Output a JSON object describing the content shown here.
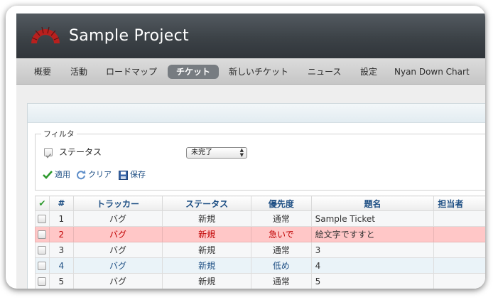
{
  "header": {
    "project_title": "Sample Project",
    "logo_icon": "redmine-logo-icon"
  },
  "menu": {
    "items": [
      {
        "label": "概要"
      },
      {
        "label": "活動"
      },
      {
        "label": "ロードマップ"
      },
      {
        "label": "チケット",
        "selected": true
      },
      {
        "label": "新しいチケット"
      },
      {
        "label": "ニュース"
      },
      {
        "label": "設定"
      },
      {
        "label": "Nyan Down Chart"
      }
    ]
  },
  "filters": {
    "legend": "フィルタ",
    "status_label": "ステータス",
    "status_checked": true,
    "status_operator": "未完了",
    "apply_label": "適用",
    "clear_label": "クリア",
    "save_label": "保存",
    "icons": [
      "checkmark-icon",
      "refresh-icon",
      "save-disk-icon"
    ]
  },
  "issues": {
    "headers": {
      "check": "✔",
      "id": "#",
      "tracker": "トラッカー",
      "status": "ステータス",
      "priority": "優先度",
      "subject": "題名",
      "assignee": "担当者"
    },
    "rows": [
      {
        "id": "1",
        "tracker": "バグ",
        "status": "新規",
        "priority": "通常",
        "subject": "Sample Ticket",
        "assignee": "",
        "style": "odd"
      },
      {
        "id": "2",
        "tracker": "バグ",
        "status": "新規",
        "priority": "急いで",
        "subject": "絵文字ですすと",
        "assignee": "",
        "style": "urgent"
      },
      {
        "id": "3",
        "tracker": "バグ",
        "status": "新規",
        "priority": "通常",
        "subject": "3",
        "assignee": "",
        "style": "odd"
      },
      {
        "id": "4",
        "tracker": "バグ",
        "status": "新規",
        "priority": "低め",
        "subject": "4",
        "assignee": "",
        "style": "low"
      },
      {
        "id": "5",
        "tracker": "バグ",
        "status": "新規",
        "priority": "通常",
        "subject": "5",
        "assignee": "",
        "style": "odd"
      }
    ]
  },
  "colors": {
    "header_bg": "#3c4247",
    "menu_selected_bg": "#777c81",
    "link": "#1e4f84",
    "urgent_row_bg": "#ffc7c7",
    "urgent_text": "#c00000",
    "low_row_bg": "#eaf3f8"
  }
}
